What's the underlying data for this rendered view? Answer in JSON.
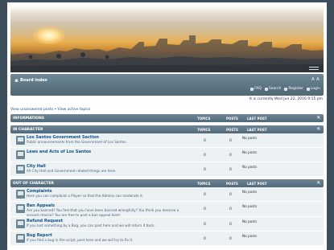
{
  "header": {
    "board_index": "Board index",
    "font_size": "A A",
    "user_links": [
      {
        "label": "FAQ",
        "icon": "faq-icon"
      },
      {
        "label": "Search",
        "icon": "search-icon"
      },
      {
        "label": "Register",
        "icon": "register-icon"
      },
      {
        "label": "Login",
        "icon": "login-icon"
      }
    ],
    "date": "It is currently Wed Jun 22, 2016 9:15 pm"
  },
  "view_links": {
    "unanswered": "View unanswered posts",
    "separator": " • ",
    "active": "View active topics"
  },
  "columns": {
    "topics": "TOPICS",
    "posts": "POSTS",
    "last": "LAST POST"
  },
  "categories": [
    {
      "name": "INFORMATIONS",
      "forums": []
    },
    {
      "name": "IN CHARACTER",
      "forums": [
        {
          "title": "Los Santos Government Section",
          "desc": "Public announcements from the Government of Los Santos.",
          "topics": "0",
          "posts": "0",
          "last": "No posts"
        },
        {
          "title": "Laws and Acts of Los Santos",
          "desc": "",
          "topics": "0",
          "posts": "0",
          "last": "No posts"
        },
        {
          "title": "City Hall",
          "desc": "All City Hall and Government related things are here.",
          "topics": "0",
          "posts": "0",
          "last": "No posts"
        }
      ]
    },
    {
      "name": "OUT OF CHARACTER",
      "forums": [
        {
          "title": "Complaints",
          "desc": "Here you can complaint a Player so that the Admins can moderate it.",
          "topics": "0",
          "posts": "0",
          "last": "No posts"
        },
        {
          "title": "Ban Appeals",
          "desc": "Are you banned? You feel that you have been banned wrongfully? You think you deserve a second chance? You are free to post a ban appeal here!",
          "topics": "0",
          "posts": "0",
          "last": "No posts"
        },
        {
          "title": "Refund Request",
          "desc": "If you lost something by a Bug, you can post here and we will return it back.",
          "topics": "0",
          "posts": "0",
          "last": "No posts"
        },
        {
          "title": "Bug Report",
          "desc": "If you find a bug in the script, post here and we will try to fix it.",
          "topics": "0",
          "posts": "0",
          "last": "No posts"
        }
      ]
    }
  ],
  "colors": {
    "accent": "#105289",
    "header_bar": "#5c7584",
    "row": "#ecf1f3",
    "background": "#3d4f5c"
  }
}
